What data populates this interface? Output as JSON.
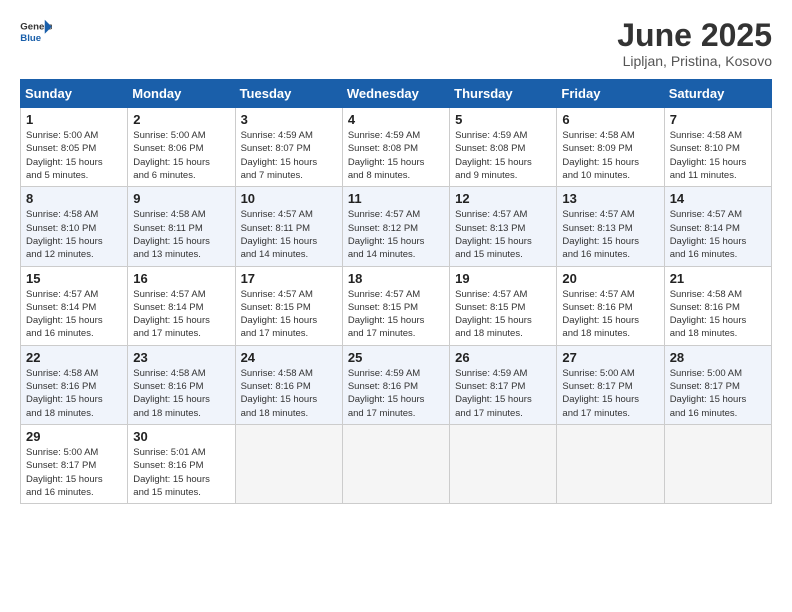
{
  "header": {
    "logo_general": "General",
    "logo_blue": "Blue",
    "title": "June 2025",
    "subtitle": "Lipljan, Pristina, Kosovo"
  },
  "calendar": {
    "days_of_week": [
      "Sunday",
      "Monday",
      "Tuesday",
      "Wednesday",
      "Thursday",
      "Friday",
      "Saturday"
    ],
    "weeks": [
      [
        {
          "day": "",
          "empty": true
        },
        {
          "day": "",
          "empty": true
        },
        {
          "day": "",
          "empty": true
        },
        {
          "day": "",
          "empty": true
        },
        {
          "day": "",
          "empty": true
        },
        {
          "day": "",
          "empty": true
        },
        {
          "day": "",
          "empty": true
        }
      ],
      [
        {
          "day": "1",
          "sunrise": "5:00 AM",
          "sunset": "8:05 PM",
          "daylight": "15 hours and 5 minutes."
        },
        {
          "day": "2",
          "sunrise": "5:00 AM",
          "sunset": "8:06 PM",
          "daylight": "15 hours and 6 minutes."
        },
        {
          "day": "3",
          "sunrise": "4:59 AM",
          "sunset": "8:07 PM",
          "daylight": "15 hours and 7 minutes."
        },
        {
          "day": "4",
          "sunrise": "4:59 AM",
          "sunset": "8:08 PM",
          "daylight": "15 hours and 8 minutes."
        },
        {
          "day": "5",
          "sunrise": "4:59 AM",
          "sunset": "8:08 PM",
          "daylight": "15 hours and 9 minutes."
        },
        {
          "day": "6",
          "sunrise": "4:58 AM",
          "sunset": "8:09 PM",
          "daylight": "15 hours and 10 minutes."
        },
        {
          "day": "7",
          "sunrise": "4:58 AM",
          "sunset": "8:10 PM",
          "daylight": "15 hours and 11 minutes."
        }
      ],
      [
        {
          "day": "8",
          "sunrise": "4:58 AM",
          "sunset": "8:10 PM",
          "daylight": "15 hours and 12 minutes."
        },
        {
          "day": "9",
          "sunrise": "4:58 AM",
          "sunset": "8:11 PM",
          "daylight": "15 hours and 13 minutes."
        },
        {
          "day": "10",
          "sunrise": "4:57 AM",
          "sunset": "8:11 PM",
          "daylight": "15 hours and 14 minutes."
        },
        {
          "day": "11",
          "sunrise": "4:57 AM",
          "sunset": "8:12 PM",
          "daylight": "15 hours and 14 minutes."
        },
        {
          "day": "12",
          "sunrise": "4:57 AM",
          "sunset": "8:13 PM",
          "daylight": "15 hours and 15 minutes."
        },
        {
          "day": "13",
          "sunrise": "4:57 AM",
          "sunset": "8:13 PM",
          "daylight": "15 hours and 16 minutes."
        },
        {
          "day": "14",
          "sunrise": "4:57 AM",
          "sunset": "8:14 PM",
          "daylight": "15 hours and 16 minutes."
        }
      ],
      [
        {
          "day": "15",
          "sunrise": "4:57 AM",
          "sunset": "8:14 PM",
          "daylight": "15 hours and 16 minutes."
        },
        {
          "day": "16",
          "sunrise": "4:57 AM",
          "sunset": "8:14 PM",
          "daylight": "15 hours and 17 minutes."
        },
        {
          "day": "17",
          "sunrise": "4:57 AM",
          "sunset": "8:15 PM",
          "daylight": "15 hours and 17 minutes."
        },
        {
          "day": "18",
          "sunrise": "4:57 AM",
          "sunset": "8:15 PM",
          "daylight": "15 hours and 17 minutes."
        },
        {
          "day": "19",
          "sunrise": "4:57 AM",
          "sunset": "8:15 PM",
          "daylight": "15 hours and 18 minutes."
        },
        {
          "day": "20",
          "sunrise": "4:57 AM",
          "sunset": "8:16 PM",
          "daylight": "15 hours and 18 minutes."
        },
        {
          "day": "21",
          "sunrise": "4:58 AM",
          "sunset": "8:16 PM",
          "daylight": "15 hours and 18 minutes."
        }
      ],
      [
        {
          "day": "22",
          "sunrise": "4:58 AM",
          "sunset": "8:16 PM",
          "daylight": "15 hours and 18 minutes."
        },
        {
          "day": "23",
          "sunrise": "4:58 AM",
          "sunset": "8:16 PM",
          "daylight": "15 hours and 18 minutes."
        },
        {
          "day": "24",
          "sunrise": "4:58 AM",
          "sunset": "8:16 PM",
          "daylight": "15 hours and 18 minutes."
        },
        {
          "day": "25",
          "sunrise": "4:59 AM",
          "sunset": "8:16 PM",
          "daylight": "15 hours and 17 minutes."
        },
        {
          "day": "26",
          "sunrise": "4:59 AM",
          "sunset": "8:17 PM",
          "daylight": "15 hours and 17 minutes."
        },
        {
          "day": "27",
          "sunrise": "5:00 AM",
          "sunset": "8:17 PM",
          "daylight": "15 hours and 17 minutes."
        },
        {
          "day": "28",
          "sunrise": "5:00 AM",
          "sunset": "8:17 PM",
          "daylight": "15 hours and 16 minutes."
        }
      ],
      [
        {
          "day": "29",
          "sunrise": "5:00 AM",
          "sunset": "8:17 PM",
          "daylight": "15 hours and 16 minutes."
        },
        {
          "day": "30",
          "sunrise": "5:01 AM",
          "sunset": "8:16 PM",
          "daylight": "15 hours and 15 minutes."
        },
        {
          "day": "",
          "empty": true
        },
        {
          "day": "",
          "empty": true
        },
        {
          "day": "",
          "empty": true
        },
        {
          "day": "",
          "empty": true
        },
        {
          "day": "",
          "empty": true
        }
      ]
    ]
  },
  "labels": {
    "sunrise_prefix": "Sunrise: ",
    "sunset_prefix": "Sunset: ",
    "daylight_prefix": "Daylight: "
  }
}
